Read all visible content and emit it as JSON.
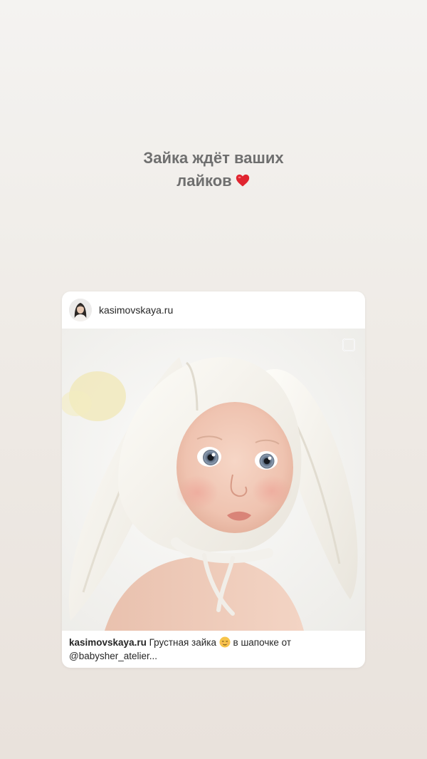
{
  "story": {
    "caption_line1": "Зайка ждёт ваших",
    "caption_line2": "лайков",
    "caption_emoji": "heart-icon",
    "caption_color": "#6f6f6f"
  },
  "post": {
    "username": "kasimovskaya.ru",
    "caption_user": "kasimovskaya.ru",
    "caption_text_before_emoji": "Грустная зайка",
    "caption_emoji": "relieved-face-icon",
    "caption_text_after_emoji": "в шапочке от",
    "caption_line2": "@babysher_atelier..."
  },
  "icons": {
    "avatar": "avatar",
    "multi_image": "multi-image-icon"
  },
  "colors": {
    "background_top": "#f4f3f1",
    "background_bottom": "#e9e2dc",
    "card": "#ffffff",
    "text": "#262626",
    "heart": "#e0242f"
  }
}
